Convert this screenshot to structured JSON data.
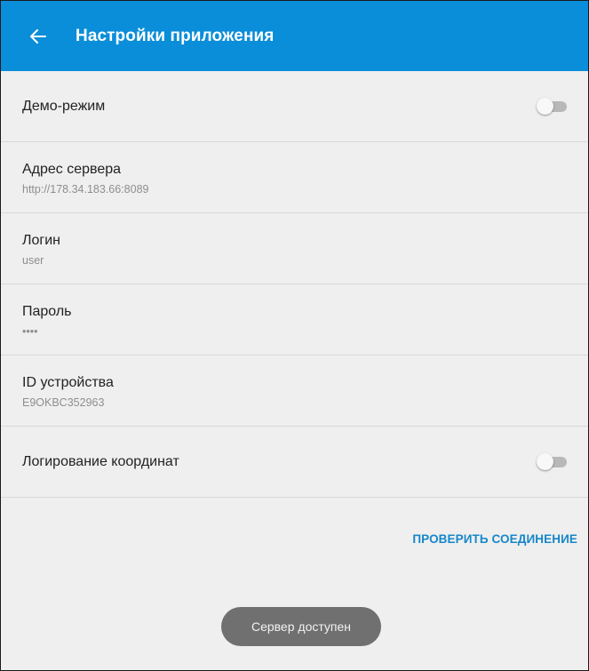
{
  "header": {
    "title": "Настройки приложения",
    "back_icon": "arrow-back-icon",
    "background_color": "#0b8ed9"
  },
  "settings": [
    {
      "name": "demo-mode",
      "label": "Демо-режим",
      "type": "toggle",
      "on": false
    },
    {
      "name": "server-address",
      "label": "Адрес сервера",
      "value": "http://178.34.183.66:8089"
    },
    {
      "name": "login",
      "label": "Логин",
      "value": "user"
    },
    {
      "name": "password",
      "label": "Пароль",
      "value": "••••"
    },
    {
      "name": "device-id",
      "label": "ID устройства",
      "value": "E9OKBC352963"
    },
    {
      "name": "coordinate-logging",
      "label": "Логирование координат",
      "type": "toggle",
      "on": false
    }
  ],
  "actions": {
    "check_connection_label": "ПРОВЕРИТЬ СОЕДИНЕНИЕ",
    "accent_color": "#1787c9"
  },
  "toast": {
    "message": "Сервер доступен"
  }
}
